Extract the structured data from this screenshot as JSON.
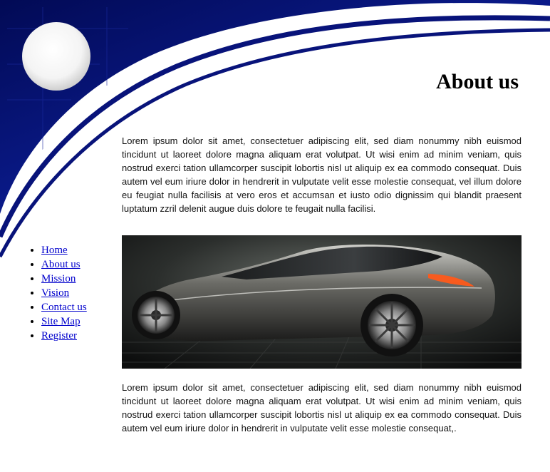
{
  "page": {
    "title": "About us"
  },
  "nav": {
    "items": [
      {
        "label": "Home"
      },
      {
        "label": "About us"
      },
      {
        "label": "Mission"
      },
      {
        "label": "Vision"
      },
      {
        "label": "Contact us"
      },
      {
        "label": "Site Map"
      },
      {
        "label": "Register"
      }
    ]
  },
  "content": {
    "intro": "Lorem ipsum dolor sit amet, consectetuer adipiscing elit, sed diam nonummy nibh euismod tincidunt ut laoreet dolore magna aliquam erat volutpat. Ut wisi enim ad minim veniam, quis nostrud exerci tation ullamcorper suscipit lobortis nisl ut aliquip ex ea commodo consequat. Duis autem vel eum iriure dolor in hendrerit in vulputate velit esse molestie consequat, vel illum dolore eu feugiat nulla facilisis at vero eros et accumsan et iusto odio dignissim qui blandit praesent luptatum zzril delenit augue duis dolore te feugait nulla facilisi.",
    "detail": "Lorem ipsum dolor sit amet, consectetuer adipiscing elit, sed diam nonummy nibh euismod tincidunt ut laoreet dolore magna aliquam erat volutpat. Ut wisi enim ad minim veniam, quis nostrud exerci tation ullamcorper suscipit lobortis nisl ut aliquip ex ea commodo consequat. Duis autem vel eum iriure dolor in hendrerit in vulputate velit esse molestie consequat,."
  },
  "theme": {
    "header_navy": "#060f6e",
    "link_color": "#0000cc"
  }
}
